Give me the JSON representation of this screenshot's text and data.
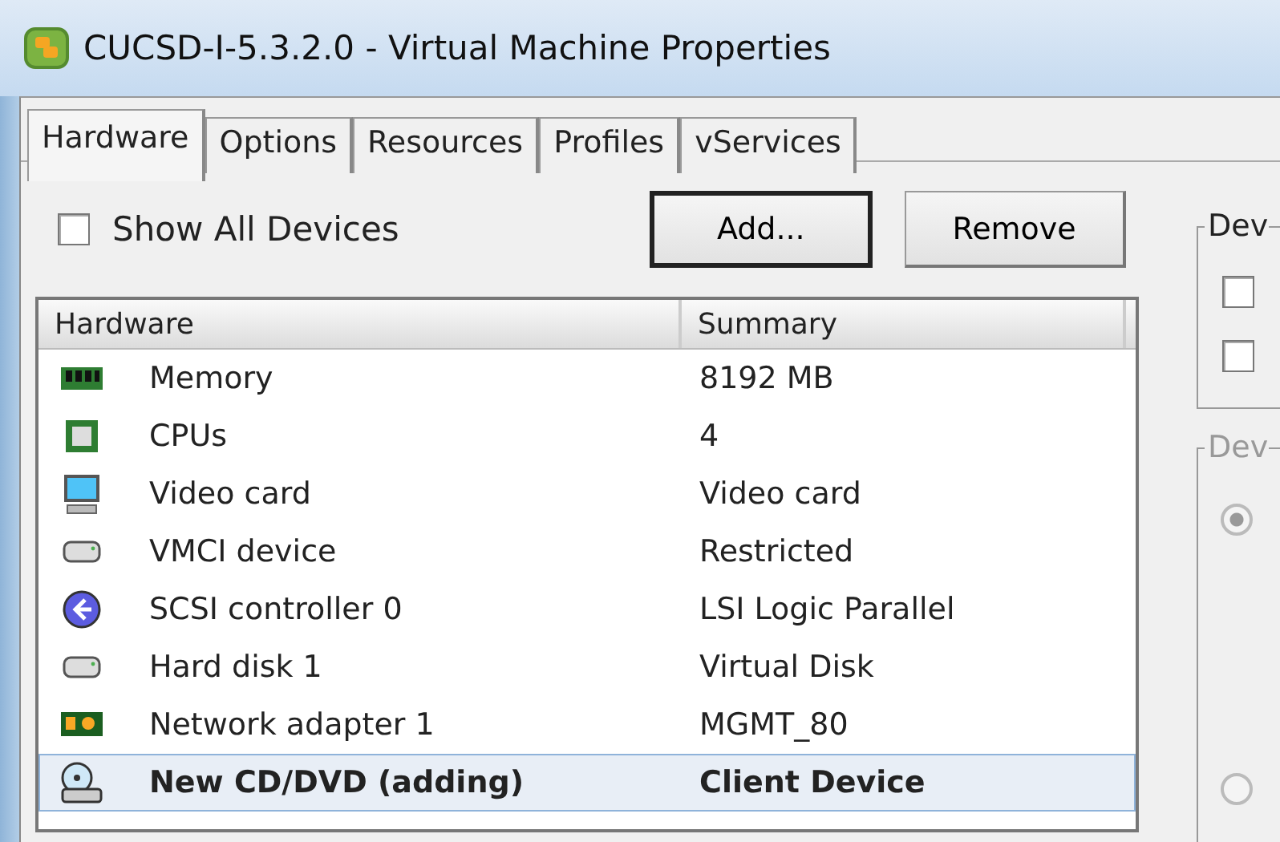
{
  "window": {
    "title": "CUCSD-I-5.3.2.0 - Virtual Machine Properties"
  },
  "tabs": [
    {
      "label": "Hardware",
      "selected": true
    },
    {
      "label": "Options",
      "selected": false
    },
    {
      "label": "Resources",
      "selected": false
    },
    {
      "label": "Profiles",
      "selected": false
    },
    {
      "label": "vServices",
      "selected": false
    }
  ],
  "show_all_devices": {
    "label": "Show All Devices",
    "checked": false
  },
  "buttons": [
    {
      "label": "Add...",
      "default": true
    },
    {
      "label": "Remove",
      "default": false
    }
  ],
  "table": {
    "columns": [
      "Hardware",
      "Summary"
    ],
    "rows": [
      {
        "kind": "memory",
        "hardware": "Memory",
        "summary": "8192 MB",
        "selected": false,
        "adding": false
      },
      {
        "kind": "cpu",
        "hardware": "CPUs",
        "summary": "4",
        "selected": false,
        "adding": false
      },
      {
        "kind": "video",
        "hardware": "Video card",
        "summary": "Video card",
        "selected": false,
        "adding": false
      },
      {
        "kind": "disk",
        "hardware": "VMCI device",
        "summary": "Restricted",
        "selected": false,
        "adding": false
      },
      {
        "kind": "scsi",
        "hardware": "SCSI controller 0",
        "summary": "LSI Logic Parallel",
        "selected": false,
        "adding": false
      },
      {
        "kind": "disk",
        "hardware": "Hard disk 1",
        "summary": "Virtual Disk",
        "selected": false,
        "adding": false
      },
      {
        "kind": "network",
        "hardware": "Network adapter 1",
        "summary": "MGMT_80",
        "selected": false,
        "adding": false
      },
      {
        "kind": "cdrom",
        "hardware": "New CD/DVD (adding)",
        "summary": "Client Device",
        "selected": true,
        "adding": true
      }
    ]
  },
  "device_status_group": {
    "legend": "Dev",
    "disabled": false,
    "checkboxes": [
      {
        "checked": false
      },
      {
        "checked": false
      }
    ]
  },
  "device_type_group": {
    "legend": "Dev",
    "disabled": true,
    "radios": [
      {
        "selected": true
      },
      {
        "selected": false
      }
    ]
  }
}
